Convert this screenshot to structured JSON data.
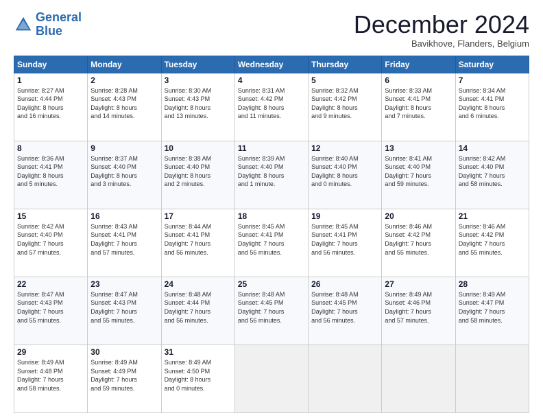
{
  "logo": {
    "line1": "General",
    "line2": "Blue"
  },
  "header": {
    "title": "December 2024",
    "subtitle": "Bavikhove, Flanders, Belgium"
  },
  "days_of_week": [
    "Sunday",
    "Monday",
    "Tuesday",
    "Wednesday",
    "Thursday",
    "Friday",
    "Saturday"
  ],
  "weeks": [
    [
      {
        "day": "1",
        "info": "Sunrise: 8:27 AM\nSunset: 4:44 PM\nDaylight: 8 hours\nand 16 minutes."
      },
      {
        "day": "2",
        "info": "Sunrise: 8:28 AM\nSunset: 4:43 PM\nDaylight: 8 hours\nand 14 minutes."
      },
      {
        "day": "3",
        "info": "Sunrise: 8:30 AM\nSunset: 4:43 PM\nDaylight: 8 hours\nand 13 minutes."
      },
      {
        "day": "4",
        "info": "Sunrise: 8:31 AM\nSunset: 4:42 PM\nDaylight: 8 hours\nand 11 minutes."
      },
      {
        "day": "5",
        "info": "Sunrise: 8:32 AM\nSunset: 4:42 PM\nDaylight: 8 hours\nand 9 minutes."
      },
      {
        "day": "6",
        "info": "Sunrise: 8:33 AM\nSunset: 4:41 PM\nDaylight: 8 hours\nand 7 minutes."
      },
      {
        "day": "7",
        "info": "Sunrise: 8:34 AM\nSunset: 4:41 PM\nDaylight: 8 hours\nand 6 minutes."
      }
    ],
    [
      {
        "day": "8",
        "info": "Sunrise: 8:36 AM\nSunset: 4:41 PM\nDaylight: 8 hours\nand 5 minutes."
      },
      {
        "day": "9",
        "info": "Sunrise: 8:37 AM\nSunset: 4:40 PM\nDaylight: 8 hours\nand 3 minutes."
      },
      {
        "day": "10",
        "info": "Sunrise: 8:38 AM\nSunset: 4:40 PM\nDaylight: 8 hours\nand 2 minutes."
      },
      {
        "day": "11",
        "info": "Sunrise: 8:39 AM\nSunset: 4:40 PM\nDaylight: 8 hours\nand 1 minute."
      },
      {
        "day": "12",
        "info": "Sunrise: 8:40 AM\nSunset: 4:40 PM\nDaylight: 8 hours\nand 0 minutes."
      },
      {
        "day": "13",
        "info": "Sunrise: 8:41 AM\nSunset: 4:40 PM\nDaylight: 7 hours\nand 59 minutes."
      },
      {
        "day": "14",
        "info": "Sunrise: 8:42 AM\nSunset: 4:40 PM\nDaylight: 7 hours\nand 58 minutes."
      }
    ],
    [
      {
        "day": "15",
        "info": "Sunrise: 8:42 AM\nSunset: 4:40 PM\nDaylight: 7 hours\nand 57 minutes."
      },
      {
        "day": "16",
        "info": "Sunrise: 8:43 AM\nSunset: 4:41 PM\nDaylight: 7 hours\nand 57 minutes."
      },
      {
        "day": "17",
        "info": "Sunrise: 8:44 AM\nSunset: 4:41 PM\nDaylight: 7 hours\nand 56 minutes."
      },
      {
        "day": "18",
        "info": "Sunrise: 8:45 AM\nSunset: 4:41 PM\nDaylight: 7 hours\nand 56 minutes."
      },
      {
        "day": "19",
        "info": "Sunrise: 8:45 AM\nSunset: 4:41 PM\nDaylight: 7 hours\nand 56 minutes."
      },
      {
        "day": "20",
        "info": "Sunrise: 8:46 AM\nSunset: 4:42 PM\nDaylight: 7 hours\nand 55 minutes."
      },
      {
        "day": "21",
        "info": "Sunrise: 8:46 AM\nSunset: 4:42 PM\nDaylight: 7 hours\nand 55 minutes."
      }
    ],
    [
      {
        "day": "22",
        "info": "Sunrise: 8:47 AM\nSunset: 4:43 PM\nDaylight: 7 hours\nand 55 minutes."
      },
      {
        "day": "23",
        "info": "Sunrise: 8:47 AM\nSunset: 4:43 PM\nDaylight: 7 hours\nand 55 minutes."
      },
      {
        "day": "24",
        "info": "Sunrise: 8:48 AM\nSunset: 4:44 PM\nDaylight: 7 hours\nand 56 minutes."
      },
      {
        "day": "25",
        "info": "Sunrise: 8:48 AM\nSunset: 4:45 PM\nDaylight: 7 hours\nand 56 minutes."
      },
      {
        "day": "26",
        "info": "Sunrise: 8:48 AM\nSunset: 4:45 PM\nDaylight: 7 hours\nand 56 minutes."
      },
      {
        "day": "27",
        "info": "Sunrise: 8:49 AM\nSunset: 4:46 PM\nDaylight: 7 hours\nand 57 minutes."
      },
      {
        "day": "28",
        "info": "Sunrise: 8:49 AM\nSunset: 4:47 PM\nDaylight: 7 hours\nand 58 minutes."
      }
    ],
    [
      {
        "day": "29",
        "info": "Sunrise: 8:49 AM\nSunset: 4:48 PM\nDaylight: 7 hours\nand 58 minutes."
      },
      {
        "day": "30",
        "info": "Sunrise: 8:49 AM\nSunset: 4:49 PM\nDaylight: 7 hours\nand 59 minutes."
      },
      {
        "day": "31",
        "info": "Sunrise: 8:49 AM\nSunset: 4:50 PM\nDaylight: 8 hours\nand 0 minutes."
      },
      {
        "day": "",
        "info": ""
      },
      {
        "day": "",
        "info": ""
      },
      {
        "day": "",
        "info": ""
      },
      {
        "day": "",
        "info": ""
      }
    ]
  ]
}
